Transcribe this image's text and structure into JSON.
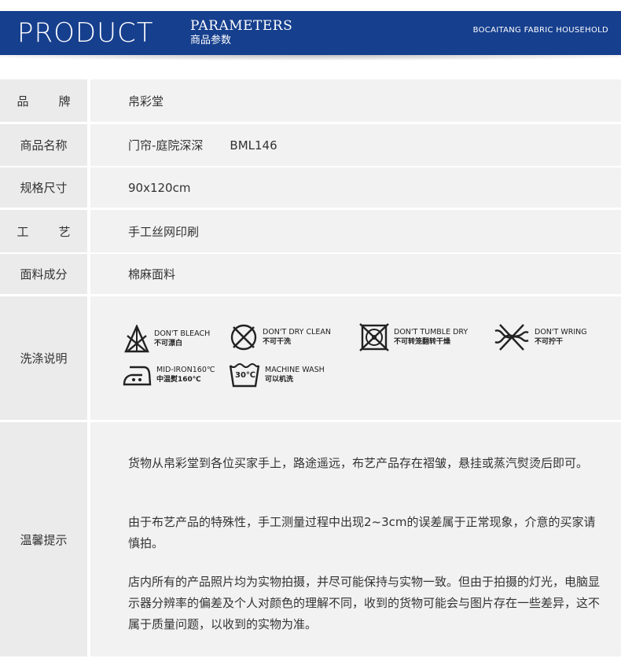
{
  "header": {
    "title": "PRODUCT",
    "subtitle_en": "PARAMETERS",
    "subtitle_cn": "商品参数",
    "brand": "BOCAITANG FABRIC HOUSEHOLD"
  },
  "colors": {
    "header_bg": "#163f8e",
    "label_bg": "#ebebeb",
    "value_bg": "#f2f2f2"
  },
  "rows": [
    {
      "label": "品牌",
      "value": "帛彩堂"
    },
    {
      "label": "商品名称",
      "value": "门帘-庭院深深",
      "code": "BML146"
    },
    {
      "label": "规格尺寸",
      "value": "90x120cm"
    },
    {
      "label": "工艺",
      "value": "手工丝网印刷"
    },
    {
      "label": "面料成分",
      "value": "棉麻面料"
    }
  ],
  "care": {
    "label": "洗涤说明",
    "items": [
      {
        "icon": "dont-bleach-icon",
        "en": "DON'T BLEACH",
        "cn": "不可漂白"
      },
      {
        "icon": "dont-dry-clean-icon",
        "en": "DON'T DRY CLEAN",
        "cn": "不可干洗"
      },
      {
        "icon": "dont-tumble-dry-icon",
        "en": "DON'T TUMBLE DRY",
        "cn": "不可转笼翻转干燥"
      },
      {
        "icon": "dont-wring-icon",
        "en": "DON'T WRING",
        "cn": "不可拧干"
      },
      {
        "icon": "mid-iron-icon",
        "en": "MID-IRON160℃",
        "cn": "中温熨160℃"
      },
      {
        "icon": "machine-wash-icon",
        "en": "MACHINE WASH",
        "cn": "可以机洗",
        "badge": "30℃"
      }
    ]
  },
  "notes": {
    "label": "温馨提示",
    "paragraphs": [
      "货物从帛彩堂到各位买家手上，路途遥远，布艺产品存在褶皱，悬挂或蒸汽熨烫后即可。",
      "由于布艺产品的特殊性，手工测量过程中出现2~3cm的误差属于正常现象，介意的买家请慎拍。",
      "店内所有的产品照片均为实物拍摄，并尽可能保持与实物一致。但由于拍摄的灯光，电脑显示器分辨率的偏差及个人对颜色的理解不同，收到的货物可能会与图片存在一些差异，这不属于质量问题，以收到的实物为准。"
    ]
  }
}
